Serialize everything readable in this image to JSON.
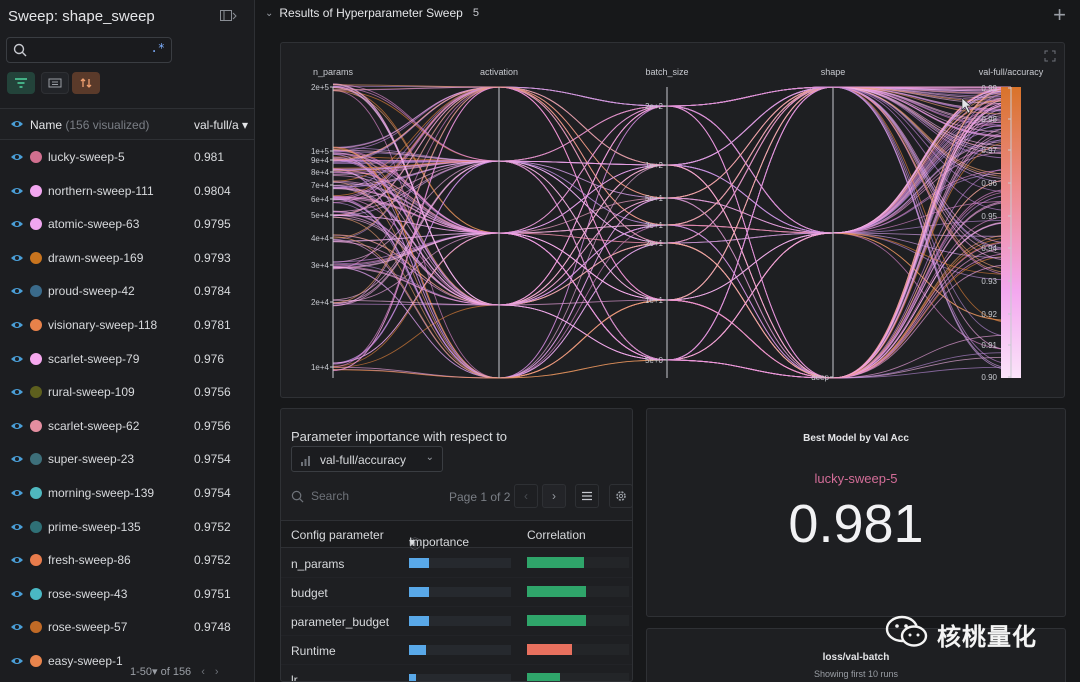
{
  "sidebar": {
    "title": "Sweep: shape_sweep",
    "header": {
      "name_label": "Name",
      "visualized": "(156 visualized)",
      "metric_label": "val-full/a"
    },
    "runs": [
      {
        "name": "lucky-sweep-5",
        "value": "0.981",
        "color": "#d16f8f"
      },
      {
        "name": "northern-sweep-111",
        "value": "0.9804",
        "color": "#f2a6ef"
      },
      {
        "name": "atomic-sweep-63",
        "value": "0.9795",
        "color": "#f0a6f0"
      },
      {
        "name": "drawn-sweep-169",
        "value": "0.9793",
        "color": "#c8741e"
      },
      {
        "name": "proud-sweep-42",
        "value": "0.9784",
        "color": "#3a6a8a"
      },
      {
        "name": "visionary-sweep-118",
        "value": "0.9781",
        "color": "#e8824a"
      },
      {
        "name": "scarlet-sweep-79",
        "value": "0.976",
        "color": "#f6a8ee"
      },
      {
        "name": "rural-sweep-109",
        "value": "0.9756",
        "color": "#5d5f1e"
      },
      {
        "name": "scarlet-sweep-62",
        "value": "0.9756",
        "color": "#e48ea0"
      },
      {
        "name": "super-sweep-23",
        "value": "0.9754",
        "color": "#3d6f7a"
      },
      {
        "name": "morning-sweep-139",
        "value": "0.9754",
        "color": "#4fb8bf"
      },
      {
        "name": "prime-sweep-135",
        "value": "0.9752",
        "color": "#2f7076"
      },
      {
        "name": "fresh-sweep-86",
        "value": "0.9752",
        "color": "#e87c4c"
      },
      {
        "name": "rose-sweep-43",
        "value": "0.9751",
        "color": "#4ab8c4"
      },
      {
        "name": "rose-sweep-57",
        "value": "0.9748",
        "color": "#c06a26"
      },
      {
        "name": "easy-sweep-1",
        "value": "",
        "color": "#e8844c"
      }
    ],
    "pagination": "1-50▾ of 156"
  },
  "section": {
    "title": "Results of Hyperparameter Sweep",
    "count": "5"
  },
  "parallel_coords": {
    "axes": [
      {
        "label": "n_params",
        "ticks": [
          "2e+5",
          "1e+5",
          "9e+4",
          "8e+4",
          "7e+4",
          "6e+4",
          "5e+4",
          "4e+4",
          "3e+4",
          "2e+4",
          "1e+4"
        ]
      },
      {
        "label": "activation",
        "ticks": []
      },
      {
        "label": "batch_size",
        "ticks": [
          "2e+2",
          "1e+2",
          "5e+1",
          "3e+1",
          "2e+1",
          "1e+1",
          "5e+0"
        ]
      },
      {
        "label": "shape",
        "ticks": [
          "deep"
        ]
      },
      {
        "label": "val-full/accuracy",
        "ticks": [
          "0.99",
          "0.98",
          "0.97",
          "0.96",
          "0.95",
          "0.94",
          "0.93",
          "0.92",
          "0.91",
          "0.90"
        ]
      }
    ]
  },
  "importance": {
    "title": "Parameter importance with respect to",
    "metric": "val-full/accuracy",
    "search_placeholder": "Search",
    "page": "Page 1 of 2",
    "columns": {
      "param": "Config parameter",
      "importance": "Importance",
      "correlation": "Correlation"
    },
    "rows": [
      {
        "name": "n_params",
        "importance": 0.2,
        "correlation": 0.56,
        "corr_color": "#2fa56a"
      },
      {
        "name": "budget",
        "importance": 0.2,
        "correlation": 0.58,
        "corr_color": "#2fa56a"
      },
      {
        "name": "parameter_budget",
        "importance": 0.2,
        "correlation": 0.58,
        "corr_color": "#2fa56a"
      },
      {
        "name": "Runtime",
        "importance": 0.17,
        "correlation": 0.44,
        "corr_color": "#e8705e"
      },
      {
        "name": "lr",
        "importance": 0.07,
        "correlation": 0.32,
        "corr_color": "#2fa56a"
      }
    ]
  },
  "best_model": {
    "title": "Best Model by Val Acc",
    "run": "lucky-sweep-5",
    "value": "0.981"
  },
  "loss_panel": {
    "title": "loss/val-batch",
    "subtitle": "Showing first 10 runs"
  },
  "watermark": {
    "text": "核桃量化"
  }
}
